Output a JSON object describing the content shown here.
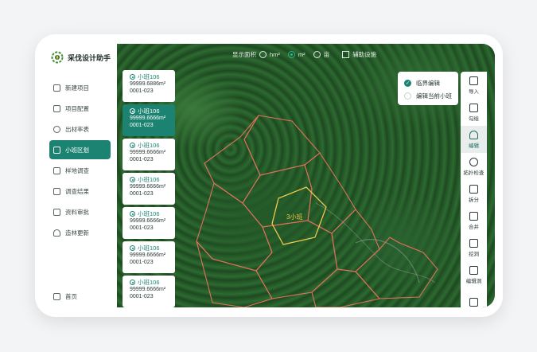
{
  "app": {
    "title": "采伐设计助手"
  },
  "sidebar": {
    "items": [
      {
        "label": "新建项目",
        "icon": "new-project-icon"
      },
      {
        "label": "项目配置",
        "icon": "config-icon"
      },
      {
        "label": "出材率表",
        "icon": "yield-table-icon"
      },
      {
        "label": "小班区划",
        "icon": "plot-division-icon",
        "active": true
      },
      {
        "label": "样地调查",
        "icon": "sample-survey-icon"
      },
      {
        "label": "调查结果",
        "icon": "survey-result-icon"
      },
      {
        "label": "资料审批",
        "icon": "approval-icon"
      },
      {
        "label": "造林更新",
        "icon": "reforest-icon"
      }
    ],
    "home_label": "首页"
  },
  "topbar": {
    "area_label": "显示面积",
    "unit_options": [
      "hm²",
      "m²",
      "亩"
    ],
    "selected_unit": "m²",
    "aux_label": "辅助设施"
  },
  "plots": [
    {
      "name": "小班106",
      "area": "99999.6886m²",
      "code": "0001-023"
    },
    {
      "name": "小班106",
      "area": "99999.6666m²",
      "code": "0001-023",
      "active": true
    },
    {
      "name": "小班106",
      "area": "99999.6666m²",
      "code": "0001-023"
    },
    {
      "name": "小班106",
      "area": "99999.6666m²",
      "code": "0001-023"
    },
    {
      "name": "小班106",
      "area": "99999.6666m²",
      "code": "0001-023"
    },
    {
      "name": "小班106",
      "area": "99999.6666m²",
      "code": "0001-023"
    },
    {
      "name": "小班106",
      "area": "99999.6666m²",
      "code": "0001-023"
    }
  ],
  "edit_menu": {
    "option1": "临界编辑",
    "option2": "编辑当前小班",
    "selected": "临界编辑"
  },
  "map": {
    "plot_label": "3小班",
    "plot_line_color": "#e0725a",
    "selected_line_color": "#f2c94c"
  },
  "tools": [
    {
      "label": "导入",
      "icon": "import-icon"
    },
    {
      "label": "勾绘",
      "icon": "sketch-icon"
    },
    {
      "label": "编辑",
      "icon": "edit-icon",
      "active": true
    },
    {
      "label": "拓扑检查",
      "icon": "topology-icon"
    },
    {
      "label": "拆分",
      "icon": "split-icon"
    },
    {
      "label": "合并",
      "icon": "merge-icon"
    },
    {
      "label": "挖洞",
      "icon": "hole-icon"
    },
    {
      "label": "编辑洞",
      "icon": "edit-hole-icon"
    }
  ],
  "colors": {
    "accent": "#1c8372",
    "map_base": "#24562a"
  }
}
